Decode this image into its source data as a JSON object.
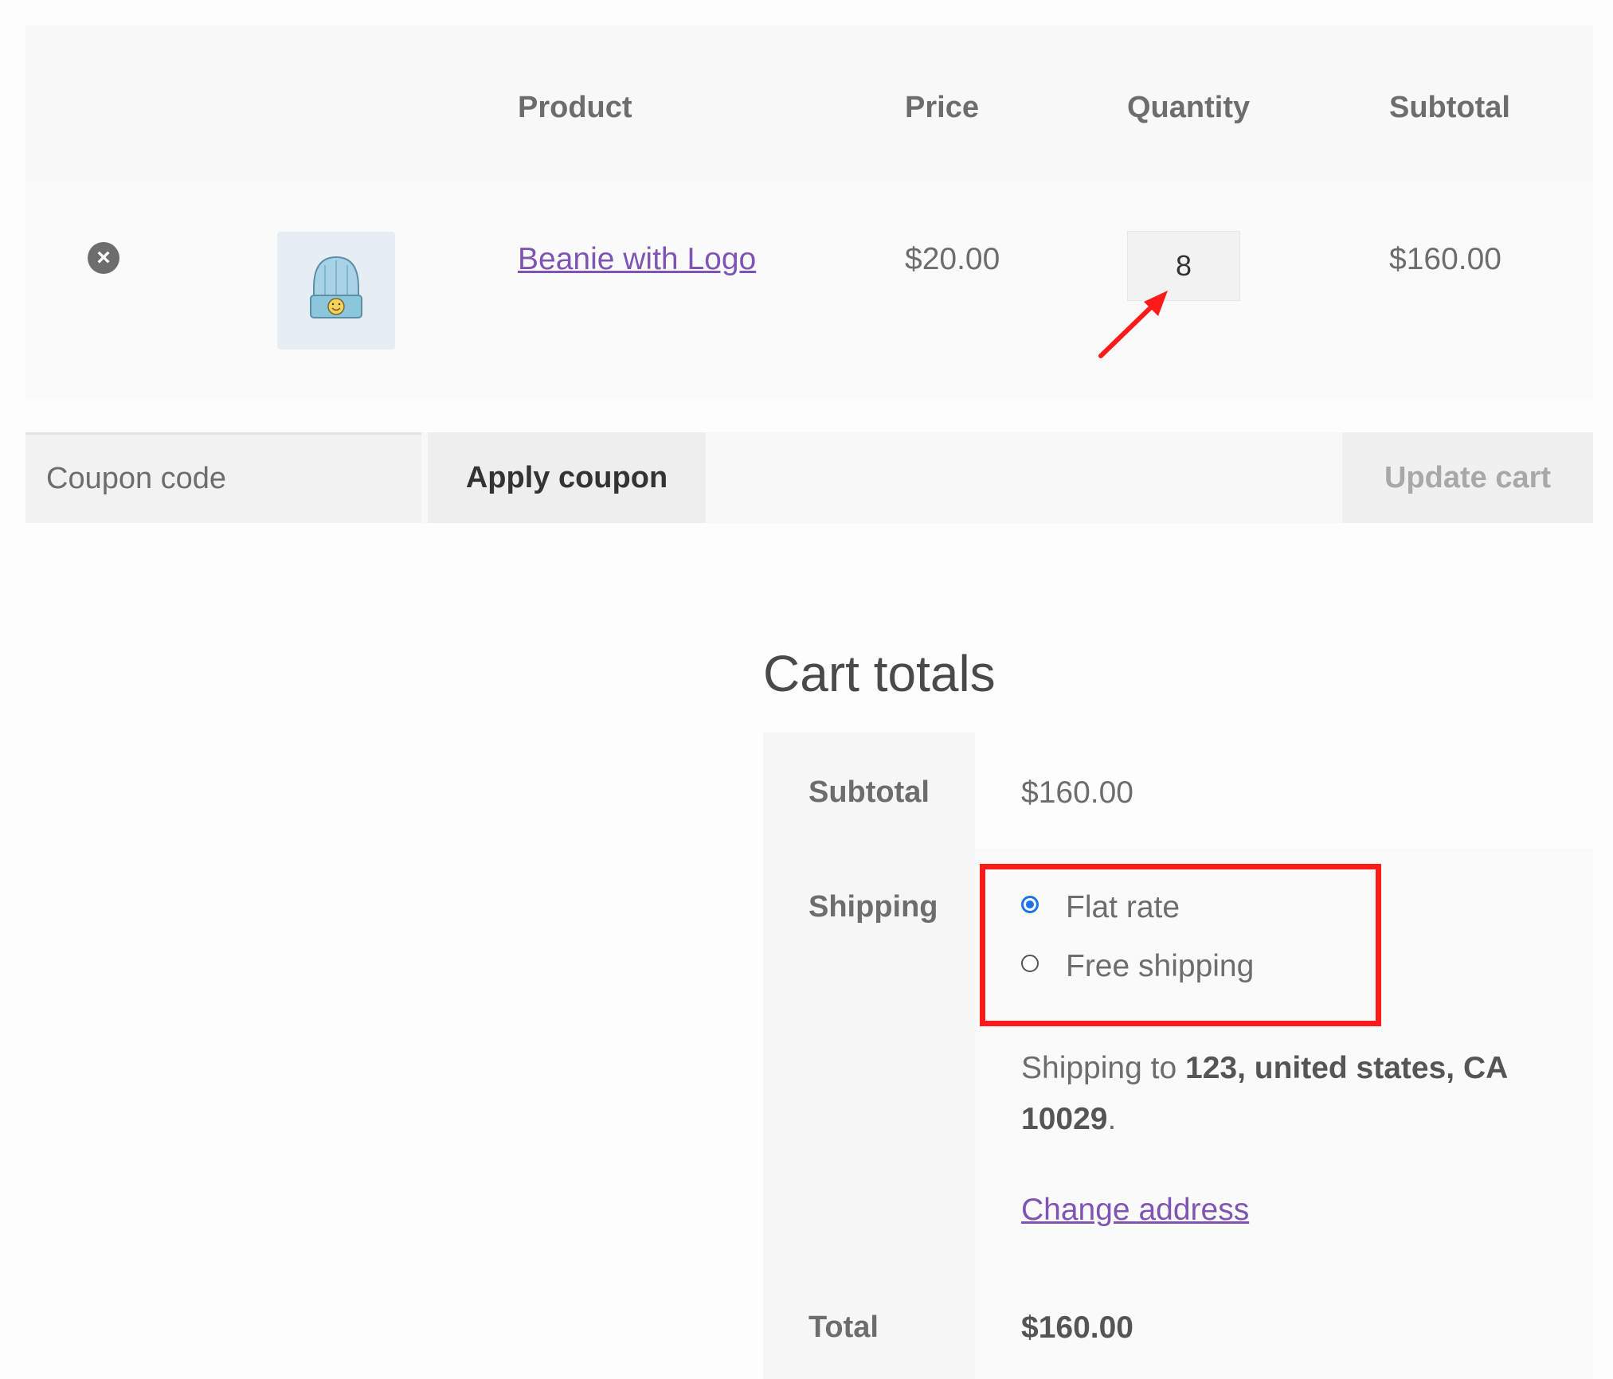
{
  "cart_table": {
    "headers": {
      "product": "Product",
      "price": "Price",
      "quantity": "Quantity",
      "subtotal": "Subtotal"
    },
    "items": [
      {
        "remove_icon": "close-circle-icon",
        "thumbnail": "beanie-with-logo-image",
        "name": "Beanie with Logo",
        "price": "$20.00",
        "quantity": "8",
        "subtotal": "$160.00"
      }
    ]
  },
  "actions": {
    "coupon_placeholder": "Coupon code",
    "apply_coupon_label": "Apply coupon",
    "update_cart_label": "Update cart"
  },
  "cart_totals": {
    "title": "Cart totals",
    "subtotal_label": "Subtotal",
    "subtotal_value": "$160.00",
    "shipping_label": "Shipping",
    "shipping_options": [
      {
        "label": "Flat rate",
        "selected": true
      },
      {
        "label": "Free shipping",
        "selected": false
      }
    ],
    "shipping_to_prefix": "Shipping to",
    "shipping_to_address": "123, united states, CA 10029",
    "shipping_to_suffix": ".",
    "change_address_label": "Change address",
    "total_label": "Total",
    "total_value": "$160.00"
  },
  "colors": {
    "link": "#7f54b3",
    "radio_selected": "#1a73e8",
    "annotation_red": "#ff1a1a"
  }
}
